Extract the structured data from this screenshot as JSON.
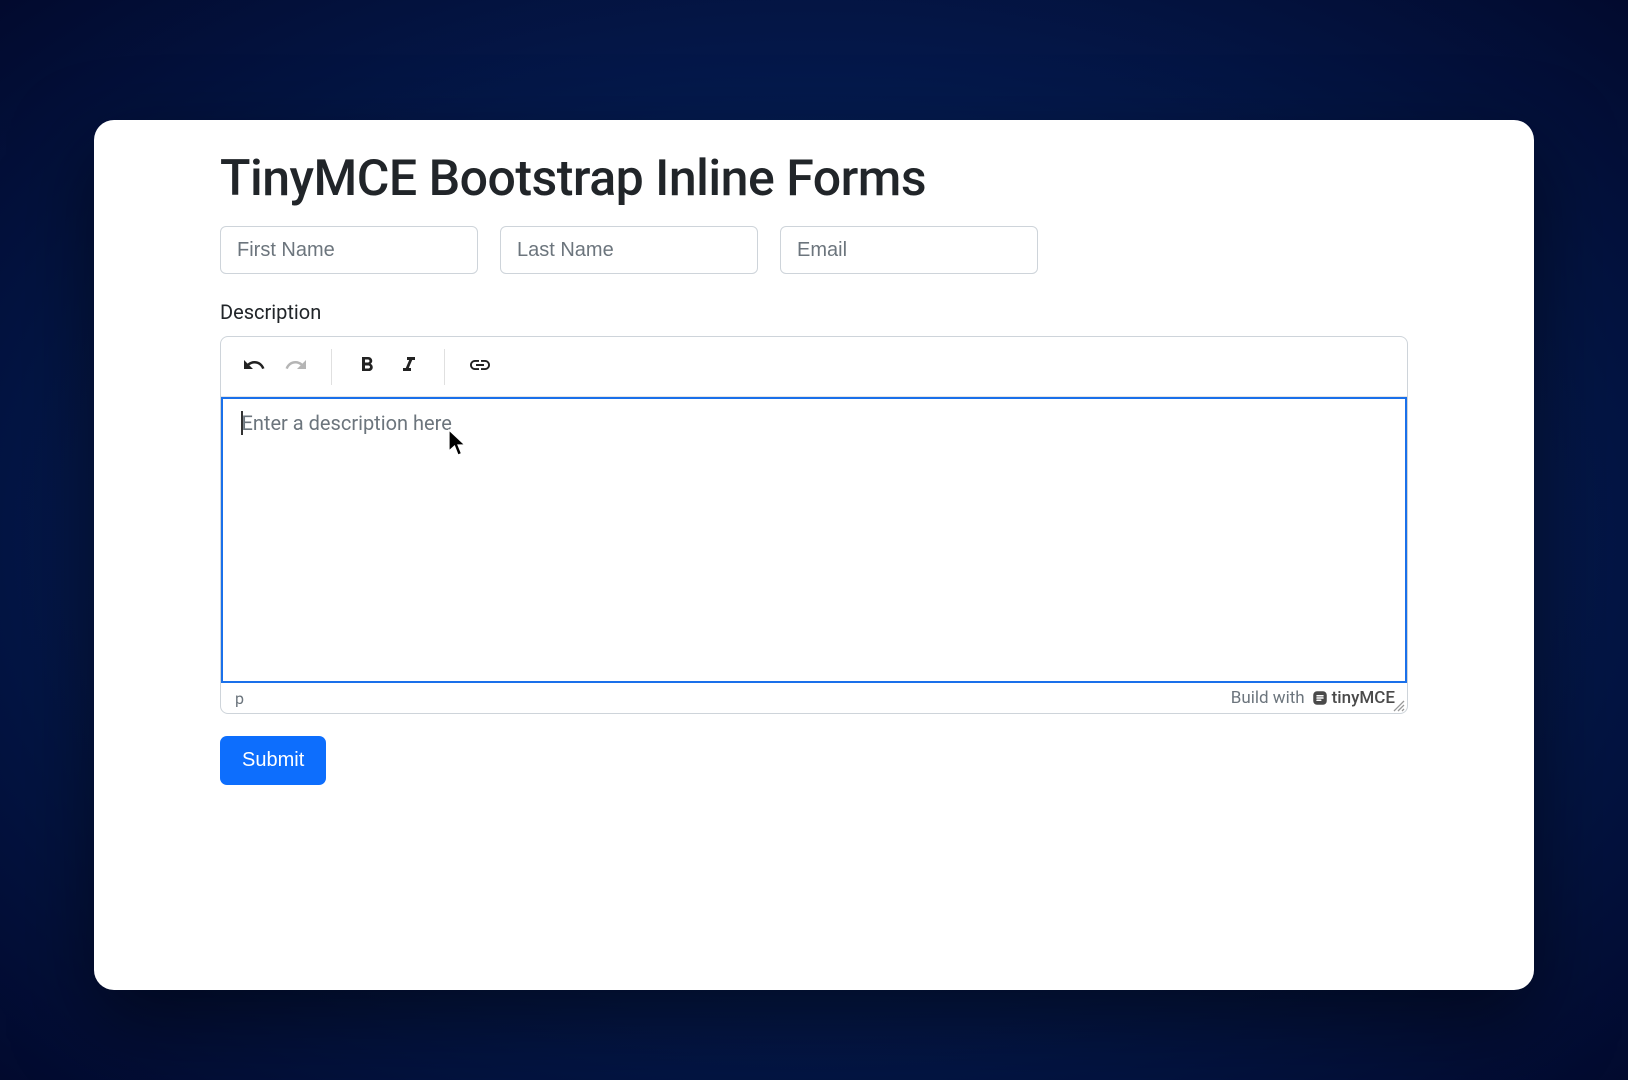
{
  "title": "TinyMCE Bootstrap Inline Forms",
  "inputs": {
    "first_name": {
      "placeholder": "First Name",
      "value": ""
    },
    "last_name": {
      "placeholder": "Last Name",
      "value": ""
    },
    "email": {
      "placeholder": "Email",
      "value": ""
    }
  },
  "description_label": "Description",
  "editor": {
    "placeholder": "Enter a description here",
    "content": "",
    "status_path": "p",
    "build_with": "Build with",
    "brand": "tinyMCE"
  },
  "submit_label": "Submit"
}
